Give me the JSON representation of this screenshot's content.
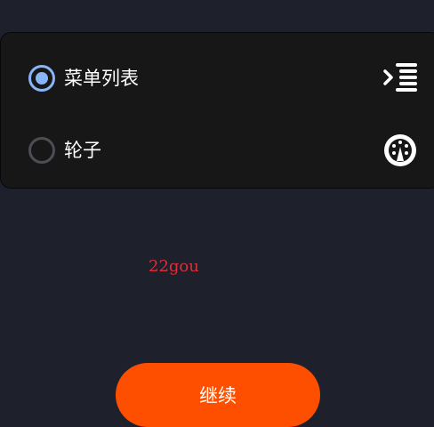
{
  "options": [
    {
      "label": "菜单列表",
      "selected": true,
      "icon": "menu-list-icon"
    },
    {
      "label": "轮子",
      "selected": false,
      "icon": "wheel-icon"
    }
  ],
  "promo_text": "22gou",
  "continue_label": "继续",
  "colors": {
    "background": "#1e202b",
    "panel": "#171717",
    "radio_selected": "#8ab4f8",
    "radio_unselected": "#4d4e53",
    "promo_text": "#d9313b",
    "button": "#fe4f00"
  }
}
